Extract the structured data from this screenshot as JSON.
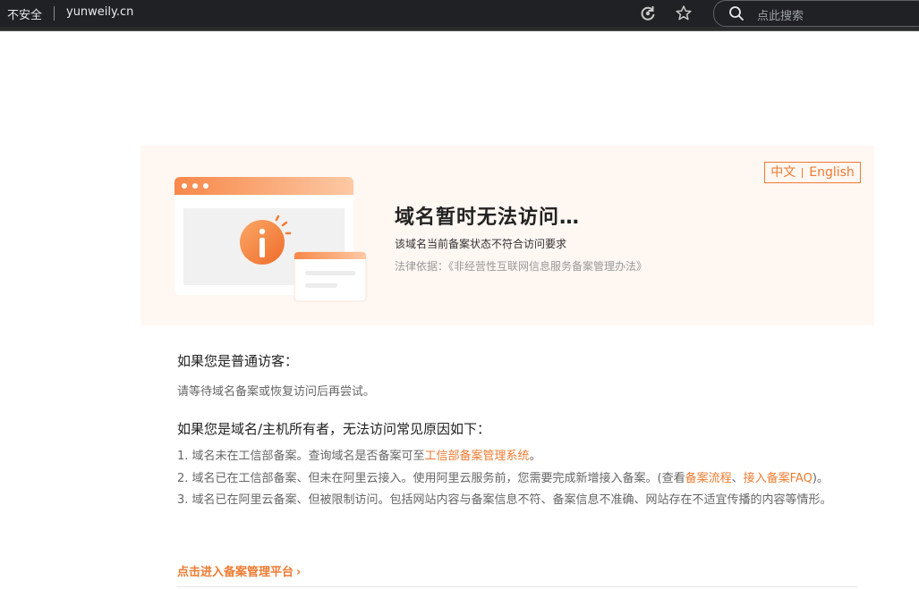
{
  "browser": {
    "security_label": "不安全",
    "url": "yunweily.cn",
    "search_placeholder": "点此搜索"
  },
  "banner": {
    "lang_cn": "中文",
    "lang_en": "English",
    "title": "域名暂时无法访问…",
    "description": "该域名当前备案状态不符合访问要求",
    "law": "法律依据：《非经营性互联网信息服务备案管理办法》"
  },
  "visitor": {
    "heading": "如果您是普通访客：",
    "text": "请等待域名备案或恢复访问后再尝试。"
  },
  "owner": {
    "heading": "如果您是域名/主机所有者，无法访问常见原因如下：",
    "reason1_text": "1. 域名未在工信部备案。查询域名是否备案可至",
    "reason1_link": "工信部备案管理系统",
    "reason1_end": "。",
    "reason2_text": "2. 域名已在工信部备案、但未在阿里云接入。使用阿里云服务前，您需要完成新增接入备案。(查看",
    "reason2_link1": "备案流程",
    "reason2_sep": "、",
    "reason2_link2": "接入备案FAQ",
    "reason2_end": ")。",
    "reason3_text": "3. 域名已在阿里云备案、但被限制访问。包括网站内容与备案信息不符、备案信息不准确、网站存在不适宜传播的内容等情形。"
  },
  "cta": {
    "label": "点击进入备案管理平台",
    "arrow": "›"
  },
  "colors": {
    "accent": "#ee7b31",
    "banner_bg": "#fff7f2",
    "chrome_bg": "#202124"
  },
  "icons": [
    "refresh-icon",
    "star-icon",
    "search-icon",
    "info-icon"
  ]
}
